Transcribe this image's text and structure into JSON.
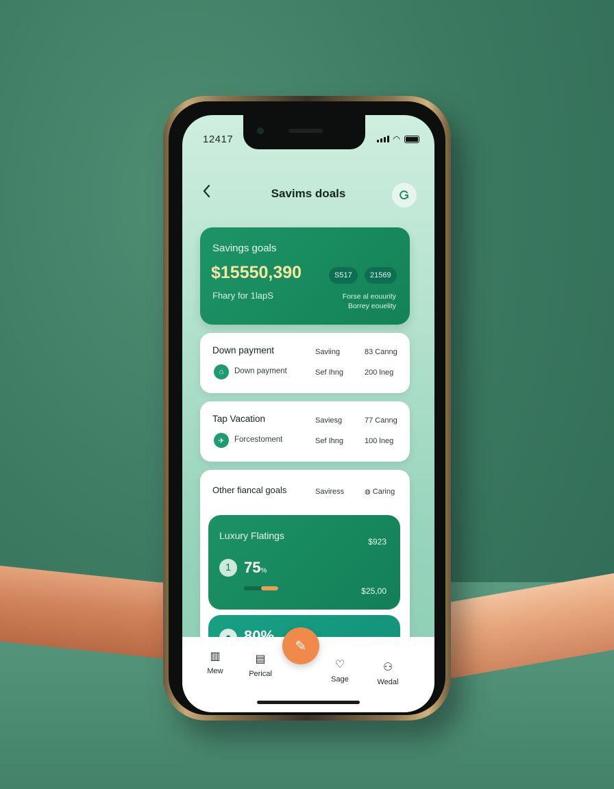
{
  "status": {
    "time": "12417"
  },
  "nav": {
    "back_icon": "chevron-left-icon",
    "title": "Savims doals",
    "action_icon": "refresh-icon"
  },
  "summary": {
    "label": "Savings goals",
    "amount": "$15550,390",
    "pill1": "S517",
    "pill2": "21569",
    "subtitle": "Fhary for 1lapS",
    "note_line1": "Forse al eouurity",
    "note_line2": "Borrey eouelity"
  },
  "cards": [
    {
      "title": "Down payment",
      "row_label": "Down payment",
      "k1": "Saviing",
      "v1": "83 Canng",
      "k2": "Sef Ihng",
      "v2": "200 lneg"
    },
    {
      "title": "Tap Vacation",
      "row_label": "Forcestoment",
      "k1": "Saviesg",
      "v1": "77 Canng",
      "k2": "Sef Ihng",
      "v2": "100 lneg"
    }
  ],
  "other": {
    "title": "Other fiancal goals",
    "k": "Saviress",
    "v": "Caring",
    "goals": [
      {
        "name": "Luxury Flatings",
        "target": "$923",
        "num": "1",
        "percent": "75",
        "unit": "%",
        "saved": "$25,00",
        "progress": 0.75
      },
      {
        "num": "",
        "percent": "80%"
      }
    ]
  },
  "tabbar": {
    "items": [
      {
        "label": "Mew",
        "icon": "chart-icon"
      },
      {
        "label": "Perical",
        "icon": "document-icon"
      },
      {
        "label": "Sage",
        "icon": "heart-icon"
      },
      {
        "label": "Wedal",
        "icon": "user-icon"
      }
    ],
    "fab_icon": "piggy-icon"
  },
  "colors": {
    "accent": "#1c9266",
    "fab": "#f08a4b",
    "highlight": "#f6e7a0"
  }
}
